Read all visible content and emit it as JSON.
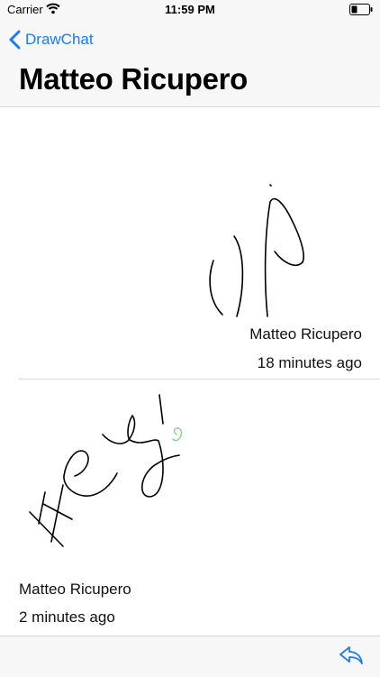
{
  "status_bar": {
    "carrier": "Carrier",
    "time": "11:59 PM",
    "wifi_icon": "wifi-icon",
    "battery_icon": "battery-icon"
  },
  "nav": {
    "back_label": "DrawChat",
    "back_icon": "chevron-left-icon",
    "title": "Matteo Ricupero"
  },
  "messages": [
    {
      "author": "Matteo Ricupero",
      "time": "18 minutes ago",
      "align": "right",
      "drawing": "up"
    },
    {
      "author": "Matteo Ricupero",
      "time": "2 minutes ago",
      "align": "left",
      "drawing": "hey"
    }
  ],
  "toolbar": {
    "reply_icon": "reply-icon"
  },
  "colors": {
    "accent": "#1a7af8",
    "ink": "#000000",
    "green_ink": "#7ed67e"
  }
}
